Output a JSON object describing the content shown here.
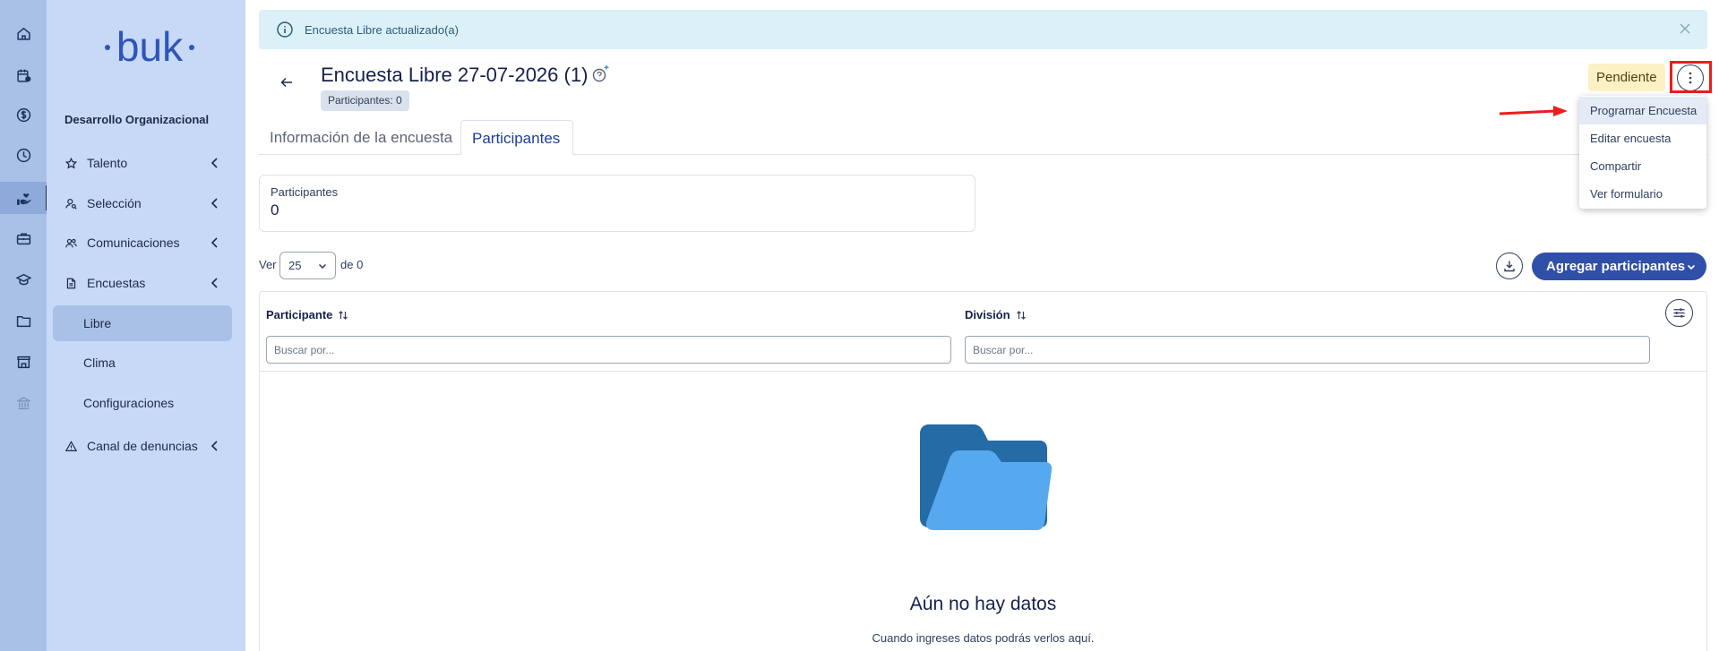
{
  "app": {
    "logo_text": "·buk·"
  },
  "rail": {
    "icons": [
      "home-icon",
      "calendar-person-icon",
      "dollar-icon",
      "clock-icon",
      "hand-heart-icon",
      "briefcase-icon",
      "graduation-cap-icon",
      "folder-icon",
      "store-icon",
      "bank-icon"
    ],
    "active_index": 4
  },
  "sidebar": {
    "section_title": "Desarrollo Organizacional",
    "items": [
      {
        "label": "Talento",
        "icon": "star-icon"
      },
      {
        "label": "Selección",
        "icon": "person-search-icon"
      },
      {
        "label": "Comunicaciones",
        "icon": "people-icon"
      },
      {
        "label": "Encuestas",
        "icon": "document-icon"
      }
    ],
    "sub_items": [
      {
        "label": "Libre",
        "active": true
      },
      {
        "label": "Clima",
        "active": false
      },
      {
        "label": "Configuraciones",
        "active": false
      }
    ],
    "last_item": {
      "label": "Canal de denuncias",
      "icon": "warning-icon"
    }
  },
  "alert": {
    "message": "Encuesta Libre actualizado(a)"
  },
  "header": {
    "title": "Encuesta Libre 27-07-2026 (1)",
    "participants_badge": "Participantes: 0",
    "status": "Pendiente"
  },
  "tabs": [
    {
      "label": "Información de la encuesta",
      "active": false
    },
    {
      "label": "Participantes",
      "active": true
    }
  ],
  "stat_card": {
    "label": "Participantes",
    "value": "0"
  },
  "pagination": {
    "ver_label": "Ver",
    "page_size": "25",
    "of_label": "de 0"
  },
  "actions": {
    "add_label": "Agregar participantes"
  },
  "table": {
    "columns": [
      {
        "label": "Participante",
        "placeholder": "Buscar por..."
      },
      {
        "label": "División",
        "placeholder": "Buscar por..."
      }
    ],
    "empty_title": "Aún no hay datos",
    "empty_subtitle": "Cuando ingreses datos podrás verlos aquí."
  },
  "menu": {
    "items": [
      "Programar Encuesta",
      "Editar encuesta",
      "Compartir",
      "Ver formulario"
    ]
  },
  "colors": {
    "rail_bg": "#a9c1e6",
    "sidebar_bg": "#c7d9f7",
    "primary": "#2f4fa8",
    "alert_bg": "#dbf1f7",
    "status_bg": "#fbf1c5",
    "annotation": "#ee1c1c"
  }
}
